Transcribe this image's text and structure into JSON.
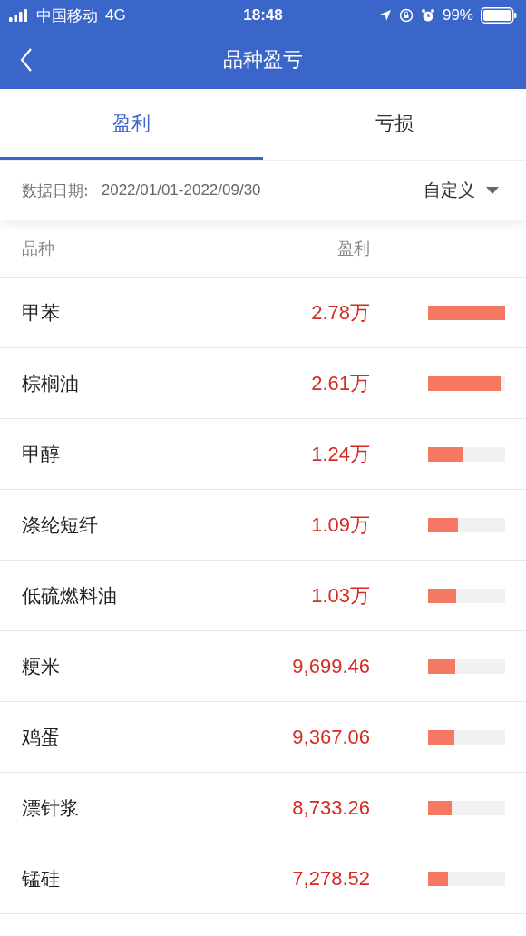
{
  "status_bar": {
    "carrier": "中国移动",
    "network": "4G",
    "time": "18:48",
    "battery": "99%"
  },
  "nav": {
    "title": "品种盈亏"
  },
  "tabs": [
    {
      "label": "盈利",
      "selected": true
    },
    {
      "label": "亏损",
      "selected": false
    }
  ],
  "filter": {
    "label": "数据日期:",
    "range": "2022/01/01-2022/09/30",
    "mode": "自定义"
  },
  "table": {
    "columns": [
      "品种",
      "盈利"
    ],
    "rows": [
      {
        "name": "甲苯",
        "value": "2.78万",
        "level": 1.0
      },
      {
        "name": "棕榈油",
        "value": "2.61万",
        "level": 0.94
      },
      {
        "name": "甲醇",
        "value": "1.24万",
        "level": 0.45
      },
      {
        "name": "涤纶短纤",
        "value": "1.09万",
        "level": 0.39
      },
      {
        "name": "低硫燃料油",
        "value": "1.03万",
        "level": 0.37
      },
      {
        "name": "粳米",
        "value": "9,699.46",
        "level": 0.35
      },
      {
        "name": "鸡蛋",
        "value": "9,367.06",
        "level": 0.34
      },
      {
        "name": "漂针浆",
        "value": "8,733.26",
        "level": 0.31
      },
      {
        "name": "锰硅",
        "value": "7,278.52",
        "level": 0.26
      }
    ]
  }
}
